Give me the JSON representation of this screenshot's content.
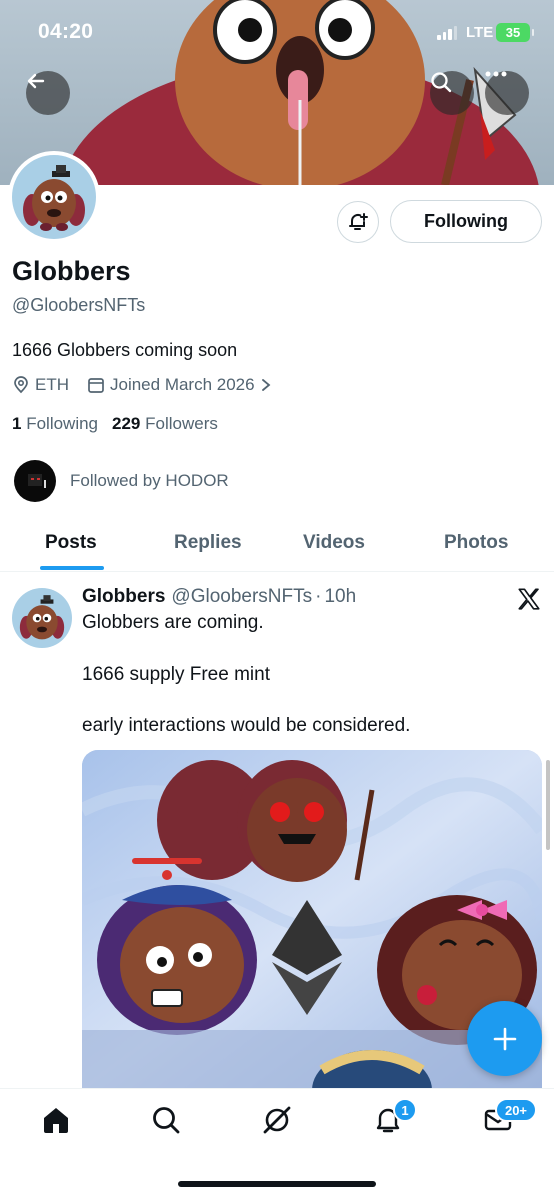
{
  "status_bar": {
    "time": "04:20",
    "network": "LTE",
    "battery": "35"
  },
  "profile": {
    "name": "Globbers",
    "handle": "@GloobersNFTs",
    "bio": "1666 Globbers coming soon",
    "location": "ETH",
    "joined": "Joined March 2026",
    "following_count": "1",
    "following_label": "Following",
    "followers_count": "229",
    "followers_label": "Followers",
    "followed_by": "Followed by HODOR",
    "follow_button_label": "Following"
  },
  "tabs": [
    {
      "label": "Posts",
      "active": true
    },
    {
      "label": "Replies",
      "active": false
    },
    {
      "label": "Videos",
      "active": false
    },
    {
      "label": "Photos",
      "active": false
    }
  ],
  "post": {
    "author": "Globbers",
    "handle": "@GloobersNFTs",
    "separator": "·",
    "time": "10h",
    "lines": [
      "Globbers are coming.",
      "1666 supply Free mint",
      "early interactions would be considered."
    ]
  },
  "bottom_nav": {
    "items": [
      "home-icon",
      "search-icon",
      "grok-icon",
      "notifications-icon",
      "messages-icon"
    ],
    "notifications_badge": "1",
    "messages_badge": "20+"
  },
  "colors": {
    "accent": "#1d9bf0",
    "text": "#0f1419",
    "muted": "#536471",
    "border": "#cfd9de"
  }
}
